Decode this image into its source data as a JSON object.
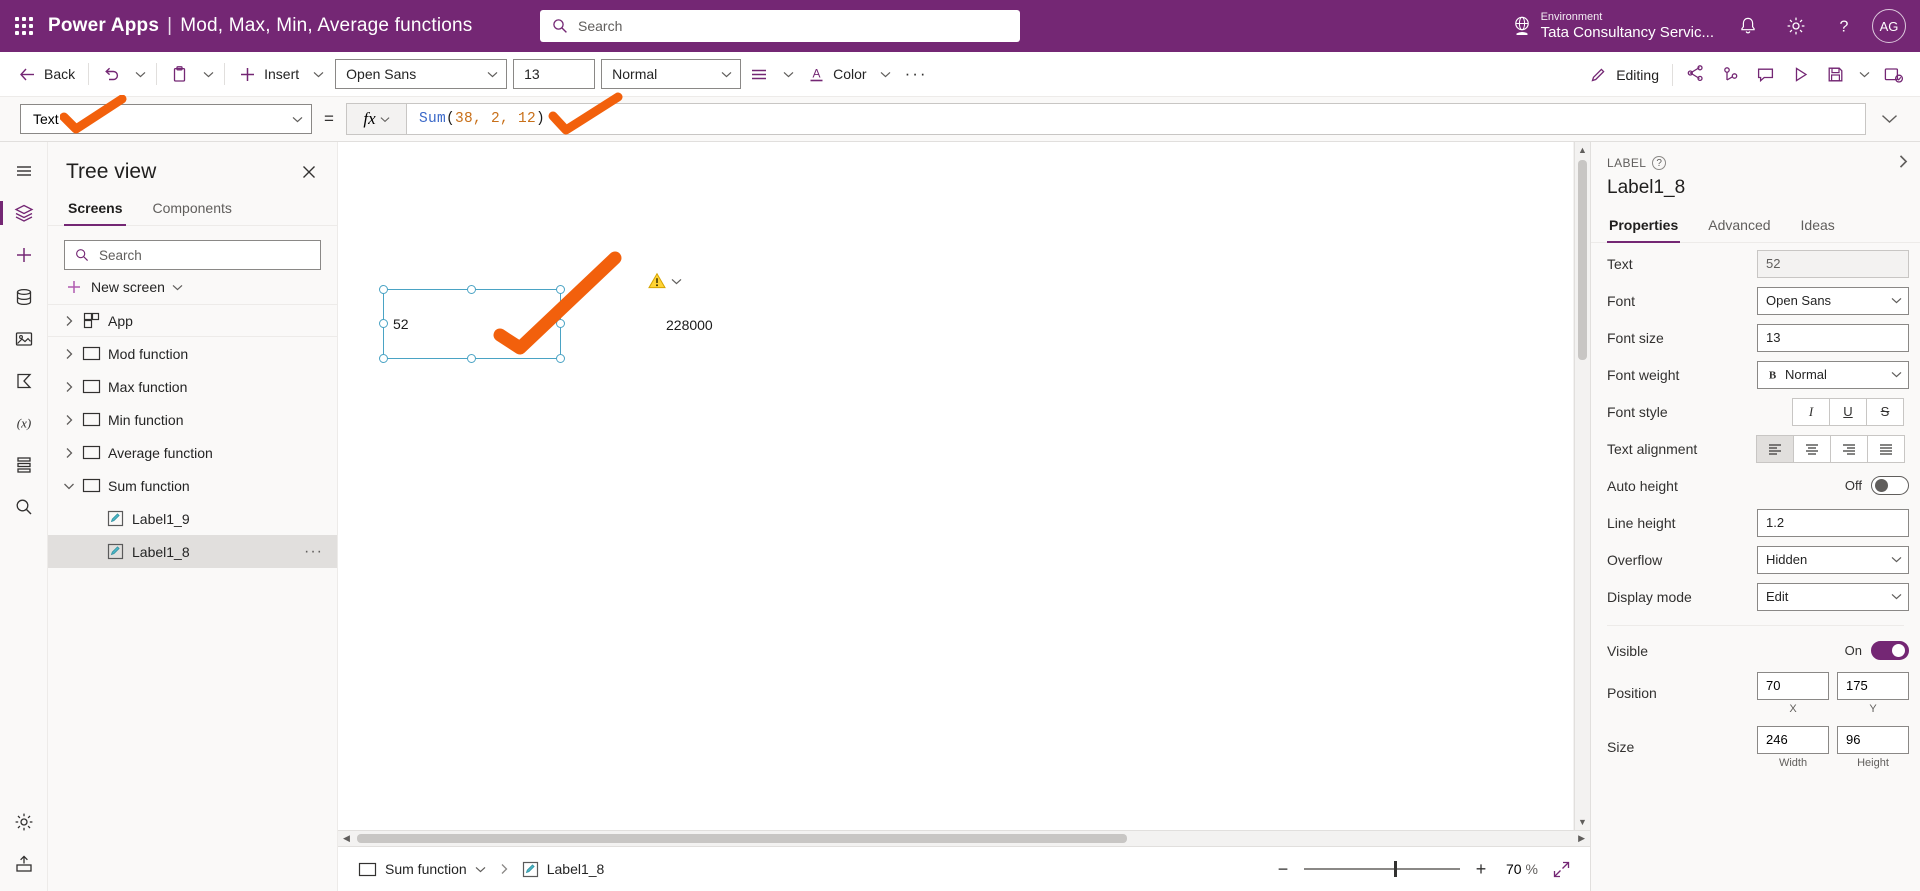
{
  "header": {
    "app_name": "Power Apps",
    "separator": "|",
    "doc_title": "Mod, Max, Min, Average functions",
    "search_placeholder": "Search",
    "environment_label": "Environment",
    "environment_name": "Tata Consultancy Servic...",
    "avatar_initials": "AG",
    "brand_color": "#742774"
  },
  "commandbar": {
    "back": "Back",
    "insert": "Insert",
    "font_family": "Open Sans",
    "font_size": "13",
    "font_weight": "Normal",
    "color": "Color",
    "more": "···",
    "editing": "Editing"
  },
  "formulabar": {
    "property": "Text",
    "equals": "=",
    "fx": "fx",
    "formula_fn": "Sum",
    "formula_open": "(",
    "formula_args": "38, 2, 12",
    "formula_close": ")",
    "formula_full": "Sum(38, 2, 12)"
  },
  "treeview": {
    "title": "Tree view",
    "tabs": [
      {
        "label": "Screens",
        "active": true
      },
      {
        "label": "Components",
        "active": false
      }
    ],
    "search_placeholder": "Search",
    "new_screen": "New screen",
    "items": [
      {
        "label": "App",
        "icon": "app-icon",
        "expanded": false,
        "level": 0,
        "selected": false
      },
      {
        "label": "Mod function",
        "icon": "screen-icon",
        "expanded": false,
        "level": 0,
        "selected": false
      },
      {
        "label": "Max function",
        "icon": "screen-icon",
        "expanded": false,
        "level": 0,
        "selected": false
      },
      {
        "label": "Min function",
        "icon": "screen-icon",
        "expanded": false,
        "level": 0,
        "selected": false
      },
      {
        "label": "Average function",
        "icon": "screen-icon",
        "expanded": false,
        "level": 0,
        "selected": false
      },
      {
        "label": "Sum function",
        "icon": "screen-icon",
        "expanded": true,
        "level": 0,
        "selected": false
      },
      {
        "label": "Label1_9",
        "icon": "label-icon",
        "expanded": null,
        "level": 1,
        "selected": false
      },
      {
        "label": "Label1_8",
        "icon": "label-icon",
        "expanded": null,
        "level": 1,
        "selected": true
      }
    ]
  },
  "canvas": {
    "selected_label_text": "52",
    "output_text": "228000",
    "warning_icon": "warning-icon"
  },
  "statusbar": {
    "screen_name": "Sum function",
    "control_name": "Label1_8",
    "zoom_value": "70",
    "zoom_unit": "%"
  },
  "properties": {
    "kind": "LABEL",
    "name": "Label1_8",
    "tabs": [
      {
        "label": "Properties",
        "active": true
      },
      {
        "label": "Advanced",
        "active": false
      },
      {
        "label": "Ideas",
        "active": false
      }
    ],
    "rows": [
      {
        "label": "Text",
        "value": "52",
        "type": "readonly"
      },
      {
        "label": "Font",
        "value": "Open Sans",
        "type": "select"
      },
      {
        "label": "Font size",
        "value": "13",
        "type": "input"
      },
      {
        "label": "Font weight",
        "value": "Normal",
        "type": "select-bold"
      },
      {
        "label": "Font style",
        "value": "",
        "type": "style-seg"
      },
      {
        "label": "Text alignment",
        "value": "",
        "type": "align-seg"
      },
      {
        "label": "Auto height",
        "value": "Off",
        "type": "toggle-off"
      },
      {
        "label": "Line height",
        "value": "1.2",
        "type": "input"
      },
      {
        "label": "Overflow",
        "value": "Hidden",
        "type": "select"
      },
      {
        "label": "Display mode",
        "value": "Edit",
        "type": "select"
      }
    ],
    "visible_label": "Visible",
    "visible_state": "On",
    "position_label": "Position",
    "position_x": "70",
    "position_y": "175",
    "position_x_cap": "X",
    "position_y_cap": "Y",
    "size_label": "Size",
    "size_width": "246",
    "size_height": "96",
    "size_width_cap": "Width",
    "size_height_cap": "Height",
    "font_style_italic": "I",
    "font_style_underline": "U",
    "font_style_strike": "S"
  },
  "annotation": {
    "color": "#f2600c"
  }
}
